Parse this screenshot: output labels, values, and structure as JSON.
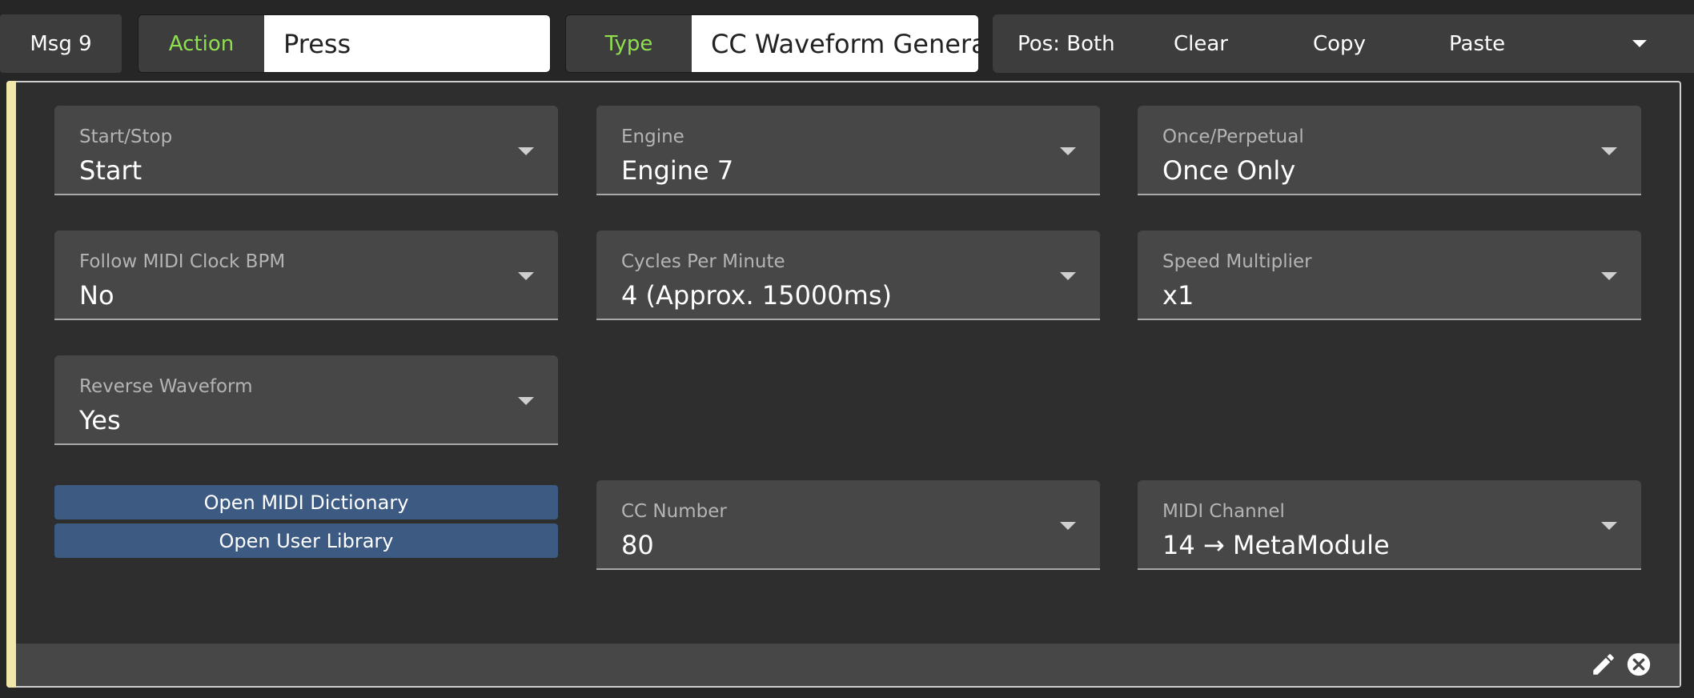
{
  "header": {
    "msg_label": "Msg 9",
    "action_key": "Action",
    "action_value": "Press",
    "type_key": "Type",
    "type_value": "CC Waveform Generator",
    "pos": "Pos: Both",
    "clear": "Clear",
    "copy": "Copy",
    "paste": "Paste",
    "menu_icon": "chevron-down-icon"
  },
  "fields": {
    "start_stop": {
      "label": "Start/Stop",
      "value": "Start"
    },
    "engine": {
      "label": "Engine",
      "value": "Engine 7"
    },
    "once_perpetual": {
      "label": "Once/Perpetual",
      "value": "Once Only"
    },
    "follow_midi_clock": {
      "label": "Follow MIDI Clock BPM",
      "value": "No"
    },
    "cycles_per_minute": {
      "label": "Cycles Per Minute",
      "value": "4 (Approx. 15000ms)"
    },
    "speed_multiplier": {
      "label": "Speed Multiplier",
      "value": "x1"
    },
    "reverse_waveform": {
      "label": "Reverse Waveform",
      "value": "Yes"
    },
    "cc_number": {
      "label": "CC Number",
      "value": "80"
    },
    "midi_channel": {
      "label": "MIDI Channel",
      "value": "14 → MetaModule"
    }
  },
  "buttons": {
    "open_midi_dictionary": "Open MIDI Dictionary",
    "open_user_library": "Open User Library"
  },
  "footer": {
    "edit_icon": "pencil-icon",
    "close_icon": "close-circle-icon"
  },
  "colors": {
    "accent_green": "#8fe051",
    "button_blue": "#3c5a82",
    "panel_accent": "#f0e7a8"
  }
}
